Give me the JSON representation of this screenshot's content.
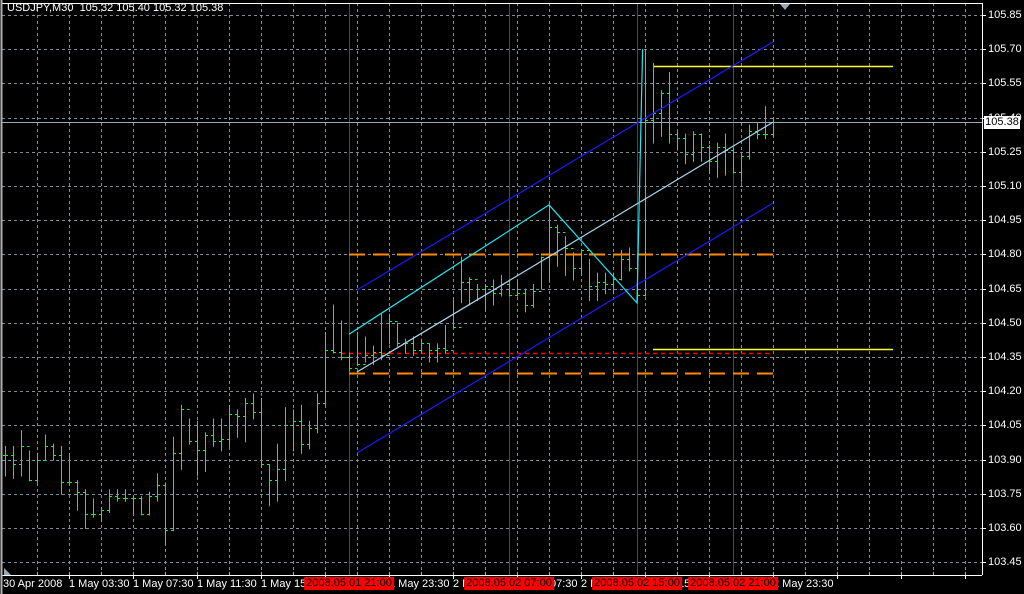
{
  "header": {
    "symbol": "USDJPY,M30",
    "open": "105.32",
    "high": "105.40",
    "low": "105.32",
    "close": "105.38"
  },
  "colors": {
    "background": "#000000",
    "grid": "#7f8c9c",
    "bars": "#22ee22",
    "axis": "#ffffff",
    "marker_red": "#ff0000",
    "channel_blue": "#1a1aff",
    "channel_mid": "#a8d8f0",
    "zigzag": "#22e6f0",
    "orange": "#ff8c00",
    "yellow": "#ffff33"
  },
  "price_axis": {
    "labels": [
      "105.85",
      "105.70",
      "105.55",
      "105.40",
      "105.25",
      "105.10",
      "104.95",
      "104.80",
      "104.65",
      "104.50",
      "104.35",
      "104.20",
      "104.05",
      "103.90",
      "103.75",
      "103.60",
      "103.45"
    ],
    "current_price": "105.38"
  },
  "time_axis": {
    "labels": [
      {
        "text": "30 Apr 2008",
        "bar": -0.3
      },
      {
        "text": "1 May 03:30",
        "bar": 8
      },
      {
        "text": "1 May 07:30",
        "bar": 16
      },
      {
        "text": "1 May 11:30",
        "bar": 24
      },
      {
        "text": "1 May 15:30",
        "bar": 32
      },
      {
        "text": "1 May 23:30",
        "bar": 48
      },
      {
        "text": "2 May 03:30",
        "bar": 56
      },
      {
        "text": "2 May 07:30",
        "bar": 64
      },
      {
        "text": "2 May 11:30",
        "bar": 72
      },
      {
        "text": "2 May 15:30",
        "bar": 80
      },
      {
        "text": "2 May 23:30",
        "bar": 96
      }
    ],
    "markers": [
      {
        "text": "2008.05.01 21:00",
        "bar": 43
      },
      {
        "text": "2008.05.02 07:00",
        "bar": 63
      },
      {
        "text": "2008.05.02 15:00",
        "bar": 79
      },
      {
        "text": "2008.05.02 21:00",
        "bar": 91
      }
    ]
  },
  "chart_data": {
    "type": "ohlc",
    "symbol": "USDJPY",
    "timeframe": "M30",
    "ylim": [
      103.4,
      105.9
    ],
    "bars_hlc": [
      [
        103.96,
        103.83,
        103.92
      ],
      [
        103.96,
        103.82,
        103.88
      ],
      [
        104.03,
        103.83,
        103.96
      ],
      [
        103.94,
        103.81,
        103.81
      ],
      [
        103.93,
        103.8,
        103.9
      ],
      [
        104.01,
        103.9,
        103.96
      ],
      [
        103.97,
        103.9,
        103.92
      ],
      [
        103.96,
        103.75,
        103.8
      ],
      [
        103.92,
        103.79,
        103.8
      ],
      [
        103.81,
        103.68,
        103.76
      ],
      [
        103.77,
        103.6,
        103.66
      ],
      [
        103.73,
        103.65,
        103.66
      ],
      [
        103.69,
        103.63,
        103.68
      ],
      [
        103.77,
        103.67,
        103.74
      ],
      [
        103.77,
        103.72,
        103.73
      ],
      [
        103.77,
        103.72,
        103.73
      ],
      [
        103.74,
        103.66,
        103.73
      ],
      [
        103.74,
        103.66,
        103.66
      ],
      [
        103.76,
        103.66,
        103.74
      ],
      [
        103.84,
        103.72,
        103.79
      ],
      [
        103.8,
        103.53,
        103.59
      ],
      [
        104.0,
        103.59,
        103.93
      ],
      [
        104.14,
        103.86,
        104.12
      ],
      [
        104.08,
        103.97,
        103.98
      ],
      [
        104.07,
        103.83,
        103.94
      ],
      [
        104.02,
        103.85,
        104.01
      ],
      [
        104.08,
        103.96,
        103.98
      ],
      [
        104.08,
        103.94,
        103.99
      ],
      [
        104.14,
        103.96,
        104.1
      ],
      [
        104.12,
        104.0,
        104.09
      ],
      [
        104.17,
        103.98,
        104.15
      ],
      [
        104.19,
        104.08,
        104.11
      ],
      [
        104.17,
        103.87,
        103.88
      ],
      [
        103.88,
        103.7,
        103.81
      ],
      [
        103.97,
        103.72,
        103.86
      ],
      [
        104.13,
        103.81,
        104.05
      ],
      [
        104.12,
        103.94,
        104.07
      ],
      [
        104.14,
        103.93,
        103.97
      ],
      [
        104.07,
        103.95,
        104.04
      ],
      [
        104.19,
        104.02,
        104.15
      ],
      [
        104.46,
        104.14,
        104.38
      ],
      [
        104.58,
        104.37,
        104.37
      ],
      [
        104.51,
        104.34,
        104.35
      ],
      [
        104.37,
        104.29,
        104.3
      ],
      [
        104.46,
        104.32,
        104.32
      ],
      [
        104.44,
        104.33,
        104.36
      ],
      [
        104.4,
        104.32,
        104.37
      ],
      [
        104.54,
        104.34,
        104.36
      ],
      [
        104.54,
        104.41,
        104.51
      ],
      [
        104.5,
        104.4,
        104.41
      ],
      [
        104.43,
        104.37,
        104.41
      ],
      [
        104.44,
        104.36,
        104.38
      ],
      [
        104.43,
        104.37,
        104.41
      ],
      [
        104.41,
        104.33,
        104.38
      ],
      [
        104.41,
        104.33,
        104.39
      ],
      [
        104.49,
        104.37,
        104.38
      ],
      [
        104.61,
        104.48,
        104.48
      ],
      [
        104.79,
        104.59,
        104.68
      ],
      [
        104.7,
        104.58,
        104.69
      ],
      [
        104.67,
        104.6,
        104.65
      ],
      [
        104.67,
        104.56,
        104.66
      ],
      [
        104.69,
        104.58,
        104.63
      ],
      [
        104.71,
        104.62,
        104.67
      ],
      [
        104.69,
        104.62,
        104.62
      ],
      [
        104.68,
        104.62,
        104.63
      ],
      [
        104.65,
        104.55,
        104.58
      ],
      [
        104.67,
        104.57,
        104.64
      ],
      [
        104.79,
        104.65,
        104.79
      ],
      [
        105.02,
        104.68,
        104.92
      ],
      [
        104.93,
        104.75,
        104.9
      ],
      [
        104.88,
        104.71,
        104.83
      ],
      [
        104.81,
        104.69,
        104.74
      ],
      [
        104.82,
        104.71,
        104.82
      ],
      [
        104.78,
        104.6,
        104.66
      ],
      [
        104.72,
        104.6,
        104.68
      ],
      [
        104.72,
        104.63,
        104.67
      ],
      [
        104.72,
        104.63,
        104.69
      ],
      [
        104.82,
        104.69,
        104.78
      ],
      [
        104.83,
        104.73,
        104.74
      ],
      [
        104.8,
        104.6,
        104.62
      ],
      [
        105.7,
        104.62,
        105.39
      ],
      [
        105.64,
        105.29,
        105.42
      ],
      [
        105.52,
        105.32,
        105.51
      ],
      [
        105.6,
        105.29,
        105.33
      ],
      [
        105.34,
        105.26,
        105.31
      ],
      [
        105.33,
        105.2,
        105.24
      ],
      [
        105.34,
        105.21,
        105.33
      ],
      [
        105.33,
        105.21,
        105.27
      ],
      [
        105.28,
        105.16,
        105.21
      ],
      [
        105.29,
        105.14,
        105.27
      ],
      [
        105.33,
        105.15,
        105.26
      ],
      [
        105.27,
        105.16,
        105.16
      ],
      [
        105.24,
        105.12,
        105.23
      ],
      [
        105.37,
        105.22,
        105.34
      ],
      [
        105.38,
        105.31,
        105.33
      ],
      [
        105.45,
        105.31,
        105.33
      ],
      [
        105.4,
        105.32,
        105.38
      ]
    ],
    "objects": {
      "channel_upper": [
        [
          44,
          104.644
        ],
        [
          96,
          105.732
        ]
      ],
      "channel_lower": [
        [
          44,
          103.929
        ],
        [
          96,
          105.025
        ]
      ],
      "channel_middle": [
        [
          44,
          104.284
        ],
        [
          96,
          105.38
        ]
      ],
      "zigzag": [
        [
          43,
          104.45
        ],
        [
          68,
          105.017
        ],
        [
          79,
          104.587
        ],
        [
          79.7,
          105.7
        ]
      ],
      "orange_level_high": {
        "price": 104.8,
        "from": 43,
        "to": 96
      },
      "orange_level_low": {
        "price": 104.28,
        "from": 43,
        "to": 96
      },
      "red_level": {
        "price": 104.367,
        "from": 42,
        "to": 96
      },
      "yellow_level_high": {
        "price": 105.626,
        "from": 81,
        "to": 111
      },
      "yellow_level_low": {
        "price": 104.387,
        "from": 81,
        "to": 111
      },
      "vertical_markers": [
        43,
        63,
        79,
        91
      ]
    }
  }
}
